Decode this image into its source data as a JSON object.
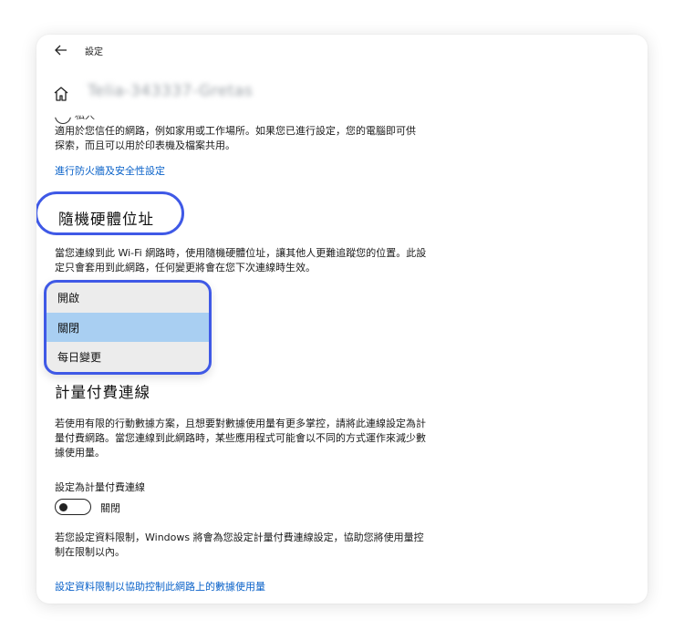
{
  "titlebar": {
    "back_icon": "arrow-left-icon",
    "title": "設定"
  },
  "header": {
    "home_icon": "home-icon",
    "network_name": "Telia-343337-Gretas"
  },
  "network_profile": {
    "option_label_partial": "私人",
    "description": "適用於您信任的網路，例如家用或工作場所。如果您已進行設定，您的電腦即可供探索，而且可以用於印表機及檔案共用。",
    "firewall_link": "進行防火牆及安全性設定"
  },
  "random_mac": {
    "heading": "隨機硬體位址",
    "description": "當您連線到此 Wi-Fi 網路時，使用隨機硬體位址，讓其他人更難追蹤您的位置。此設定只會套用到此網路，任何變更將會在您下次連線時生效。",
    "options": [
      "開啟",
      "關閉",
      "每日變更"
    ],
    "selected": "關閉",
    "highlight_color": "#3f59e6",
    "selected_color": "#a9cff2"
  },
  "metered": {
    "heading": "計量付費連線",
    "description": "若使用有限的行動數據方案，且想要對數據使用量有更多掌控，請將此連線設定為計量付費網路。當您連線到此網路時，某些應用程式可能會以不同的方式運作來減少數據使用量。",
    "toggle_label": "設定為計量付費連線",
    "toggle_state": "關閉",
    "limit_description": "若您設定資料限制，Windows 將會為您設定計量付費連線設定，協助您將使用量控制在限制以內。",
    "limit_link": "設定資料限制以協助控制此網路上的數據使用量"
  }
}
